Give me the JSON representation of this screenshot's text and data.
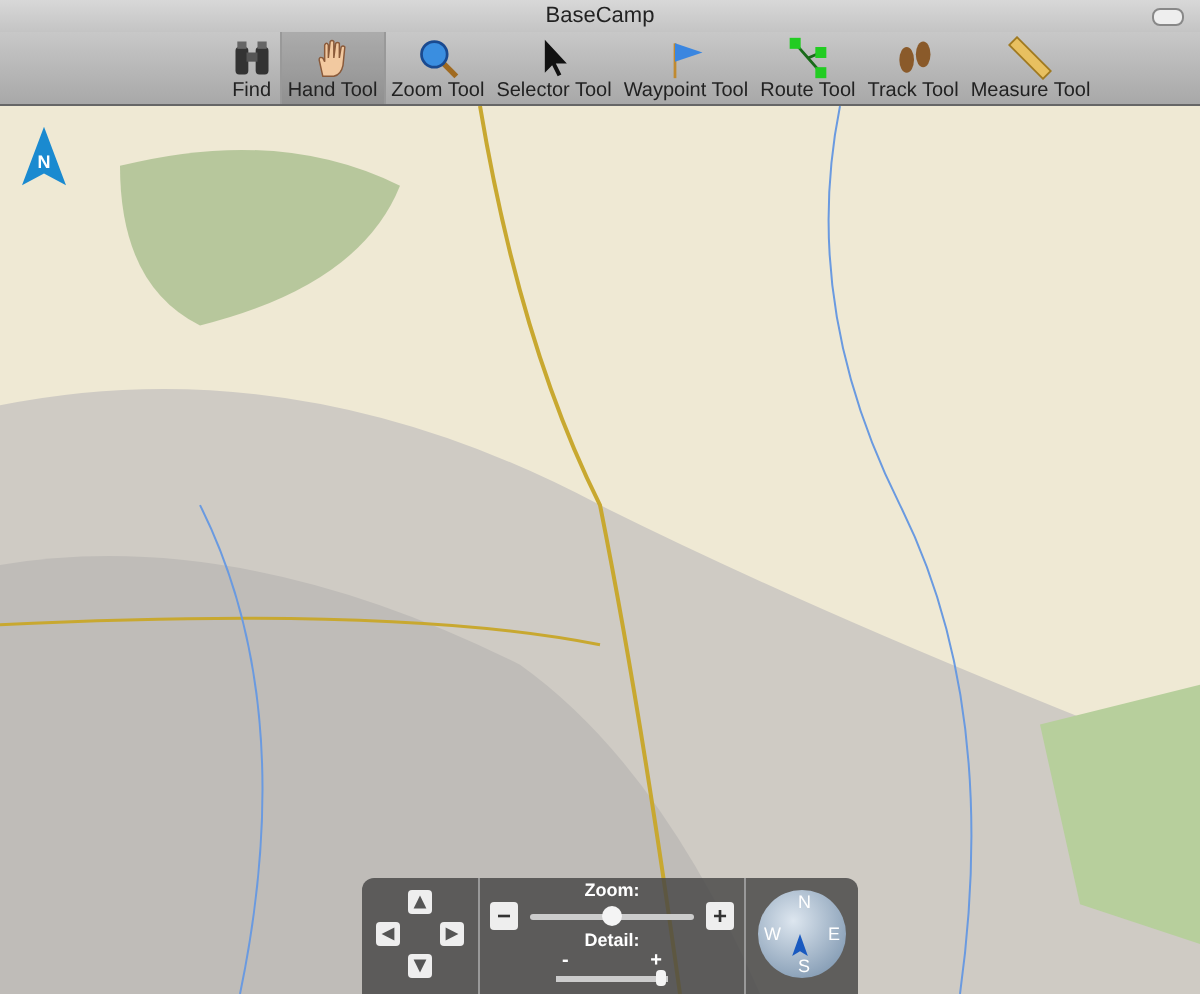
{
  "window": {
    "title": "BaseCamp"
  },
  "toolbar": [
    {
      "label": "Find",
      "kind": "binoculars",
      "selected": false
    },
    {
      "label": "Hand Tool",
      "kind": "hand",
      "selected": true
    },
    {
      "label": "Zoom Tool",
      "kind": "magnifier",
      "selected": false
    },
    {
      "label": "Selector Tool",
      "kind": "pointer",
      "selected": false
    },
    {
      "label": "Waypoint Tool",
      "kind": "flag",
      "selected": false
    },
    {
      "label": "Route Tool",
      "kind": "route",
      "selected": false
    },
    {
      "label": "Track Tool",
      "kind": "footprints",
      "selected": false
    },
    {
      "label": "Measure Tool",
      "kind": "ruler",
      "selected": false
    }
  ],
  "map": {
    "north_arrow_label": "N"
  },
  "controls": {
    "zoom": {
      "label": "Zoom:",
      "minus": "−",
      "plus": "+",
      "level": 0.5
    },
    "detail": {
      "label": "Detail:",
      "minus": "-",
      "plus": "+",
      "level": 0.95
    },
    "compass": {
      "labels": [
        "N",
        "E",
        "S",
        "W"
      ]
    }
  }
}
